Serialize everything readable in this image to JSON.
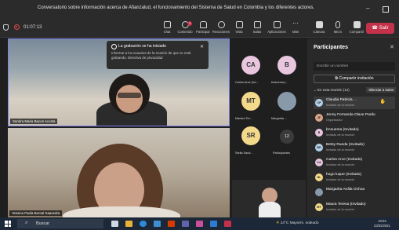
{
  "window": {
    "title": "Conversatorio sobre información acerca de Afianzalud, el funcionamiento del Sistema de Salud en Colombia y los diferentes actores."
  },
  "toolbar": {
    "timer": "01:07:13",
    "items": [
      {
        "label": "Chat",
        "icon": "chat-icon"
      },
      {
        "label": "Contenido",
        "icon": "people-icon",
        "badge": "3"
      },
      {
        "label": "Participar",
        "icon": "hand-icon"
      },
      {
        "label": "Reacciones",
        "icon": "emoji-icon"
      },
      {
        "label": "Vista",
        "icon": "grid-icon"
      },
      {
        "label": "Salas",
        "icon": "rooms-icon"
      },
      {
        "label": "Aplicaciones",
        "icon": "apps-icon"
      },
      {
        "label": "Más",
        "icon": "more-icon"
      },
      {
        "label": "Cámara",
        "icon": "camera-icon"
      },
      {
        "label": "Micro",
        "icon": "mic-icon"
      },
      {
        "label": "Compartir",
        "icon": "share-icon"
      }
    ],
    "leave_label": "Salir"
  },
  "notice": {
    "title": "La grabación se ha iniciado",
    "body": "Informar a los usuarios de la reunión de que se está grabando. Directiva de privacidad"
  },
  "tiles": [
    {
      "name": "Sandra Maria Bacon Acosta"
    },
    {
      "name": "Yessica Paola Bernal Saavedra"
    }
  ],
  "gallery": [
    {
      "initials": "CA",
      "name": "Carlos Arce (Inv...",
      "color": "#e8c6de"
    },
    {
      "initials": "B",
      "name": "bAsuema (...",
      "color": "#e8c6de"
    },
    {
      "initials": "MT",
      "name": "Mariam Ter...",
      "color": "#f3d98a"
    },
    {
      "initials": "",
      "name": "Margarita ...",
      "color": "#8899aa"
    },
    {
      "initials": "SR",
      "name": "Stella Sand...",
      "color": "#f3d98a"
    },
    {
      "initials": "12",
      "name": "Participantes",
      "color": "#3b3b3b"
    }
  ],
  "panel": {
    "title": "Participantes",
    "search_placeholder": "Escribir un nombre",
    "invite_label": "Compartir invitación",
    "section_label": "En esta reunión (12)",
    "mute_all_label": "Silenciar a todos",
    "participants": [
      {
        "initials": "CP",
        "name": "Claudia Patricia ...",
        "role": "Invitado de la reunión",
        "color": "#b3d1e8"
      },
      {
        "initials": "JF",
        "name": "Jenny Fernanda Olave Pardo",
        "role": "Organizador",
        "color": "#d9a58a"
      },
      {
        "initials": "B",
        "name": "bAsuema (Invitado)",
        "role": "Invitado de la reunión",
        "color": "#e8c6de"
      },
      {
        "initials": "BR",
        "name": "Betsy Rueda (Invitado)",
        "role": "Invitado de la reunión",
        "color": "#b3d1e8"
      },
      {
        "initials": "CA",
        "name": "Carlos Arce (Invitado)",
        "role": "Invitado de la reunión",
        "color": "#e8c6de"
      },
      {
        "initials": "HL",
        "name": "hugo luque (Invitado)",
        "role": "Invitado de la reunión",
        "color": "#f3d98a"
      },
      {
        "initials": "MA",
        "name": "Margarita Ardila Ochoa",
        "role": "",
        "color": "#8899aa"
      },
      {
        "initials": "MT",
        "name": "Maura Teresa (Invitado)",
        "role": "Invitado de la reunión",
        "color": "#f3d98a"
      }
    ]
  },
  "taskbar": {
    "search_label": "Buscar",
    "weather": "14°C  Mayorm. soleado",
    "time": "10:02",
    "date": "23/02/2021"
  }
}
